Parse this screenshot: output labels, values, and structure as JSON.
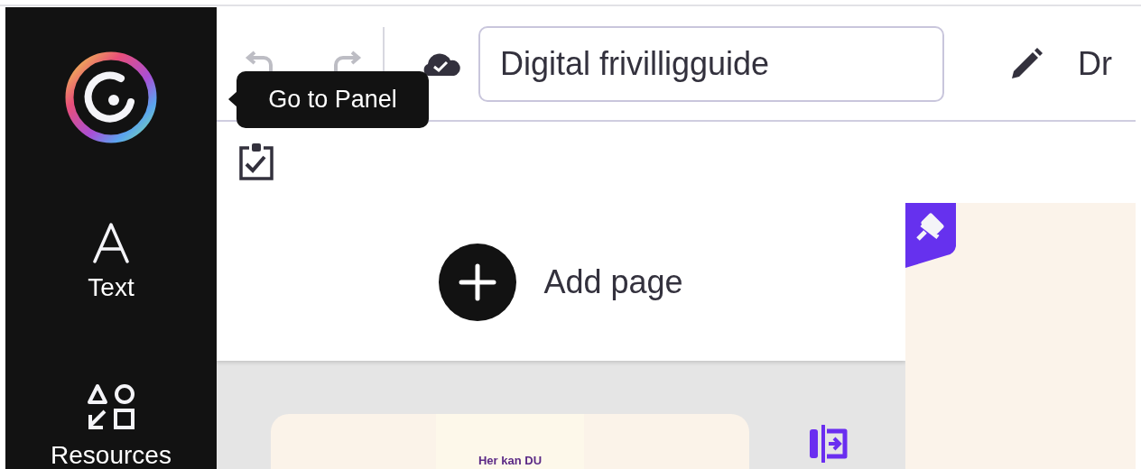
{
  "sidebar": {
    "items": [
      {
        "kind": "text",
        "label": "Text"
      },
      {
        "kind": "resources",
        "label": "Resources"
      }
    ]
  },
  "toolbar": {
    "undo": {
      "disabled": true
    },
    "redo": {
      "disabled": true
    },
    "document_title": "Digital frivilligguide",
    "next_label": "Dr"
  },
  "tooltip": {
    "text": "Go to Panel"
  },
  "add_page": {
    "label": "Add page"
  },
  "page_card": {
    "text": "Her kan DU"
  }
}
